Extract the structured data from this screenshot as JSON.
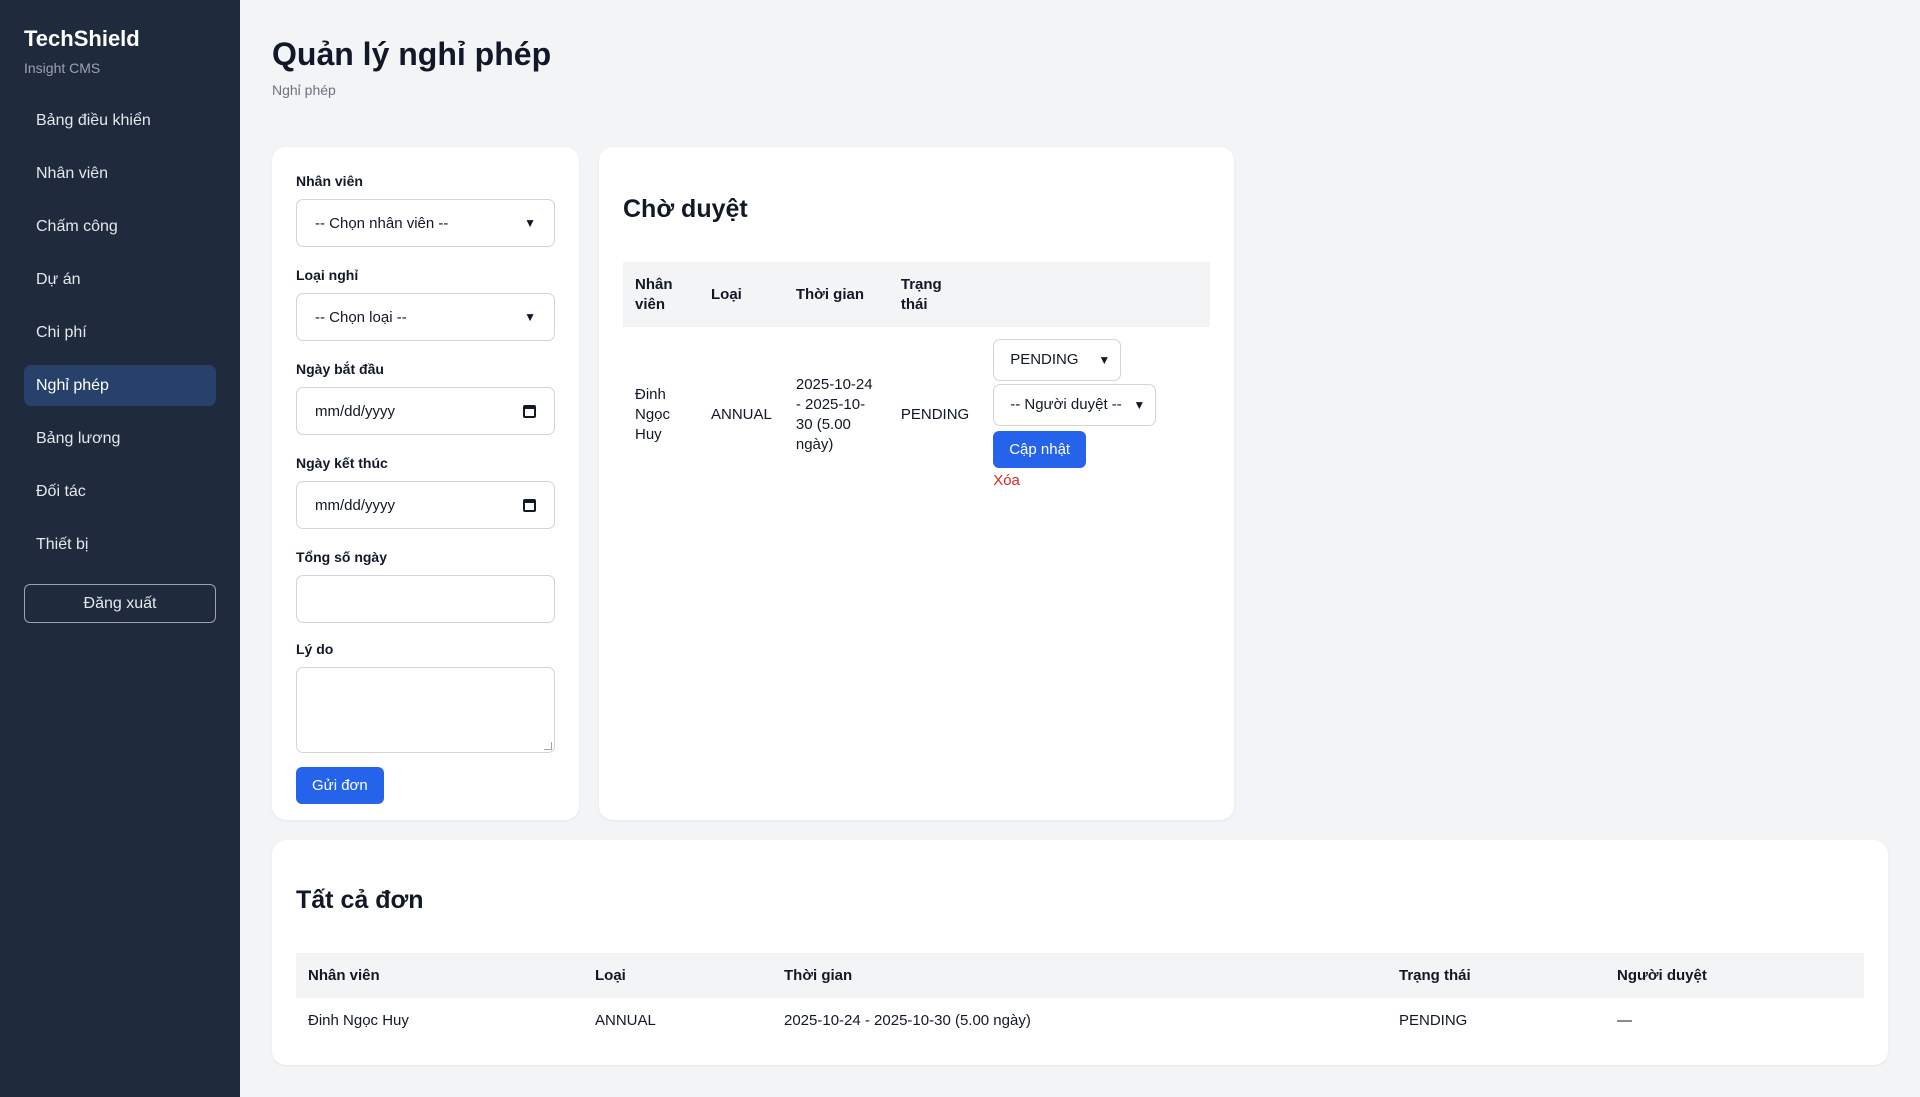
{
  "sidebar": {
    "brand": "TechShield",
    "subtitle": "Insight CMS",
    "items": [
      {
        "label": "Bảng điều khiển"
      },
      {
        "label": "Nhân viên"
      },
      {
        "label": "Chấm công"
      },
      {
        "label": "Dự án"
      },
      {
        "label": "Chi phí"
      },
      {
        "label": "Nghỉ phép"
      },
      {
        "label": "Bảng lương"
      },
      {
        "label": "Đối tác"
      },
      {
        "label": "Thiết bị"
      }
    ],
    "active_item": "Nghỉ phép",
    "logout_label": "Đăng xuất"
  },
  "header": {
    "title": "Quản lý nghỉ phép",
    "breadcrumb": "Nghỉ phép"
  },
  "form": {
    "employee_label": "Nhân viên",
    "employee_value": "-- Chọn nhân viên --",
    "type_label": "Loại nghỉ",
    "type_value": "-- Chọn loại --",
    "start_label": "Ngày bắt đầu",
    "start_value": "mm/dd/yyyy",
    "end_label": "Ngày kết thúc",
    "end_value": "mm/dd/yyyy",
    "days_label": "Tổng số ngày",
    "days_value": "",
    "reason_label": "Lý do",
    "reason_value": "",
    "submit_label": "Gửi đơn"
  },
  "pending": {
    "title": "Chờ duyệt",
    "columns": [
      "Nhân viên",
      "Loại",
      "Thời gian",
      "Trạng thái"
    ],
    "rows": [
      {
        "employee": "Đinh Ngọc Huy",
        "type": "ANNUAL",
        "period": "2025-10-24 - 2025-10-30 (5.00 ngày)",
        "status": "PENDING",
        "status_select": "PENDING",
        "approver_select": "-- Người duyệt --",
        "update_label": "Cập nhật",
        "delete_label": "Xóa"
      }
    ]
  },
  "all": {
    "title": "Tất cả đơn",
    "columns": [
      "Nhân viên",
      "Loại",
      "Thời gian",
      "Trạng thái",
      "Người duyệt"
    ],
    "rows": [
      {
        "employee": "Đinh Ngọc Huy",
        "type": "ANNUAL",
        "period": "2025-10-24 - 2025-10-30 (5.00 ngày)",
        "status": "PENDING",
        "approver": "—"
      }
    ]
  },
  "colors": {
    "sidebar_bg": "#1f2a3c",
    "active_item_bg": "#27416b",
    "primary": "#2563eb",
    "danger": "#dc2626",
    "page_bg": "#f3f4f6"
  }
}
